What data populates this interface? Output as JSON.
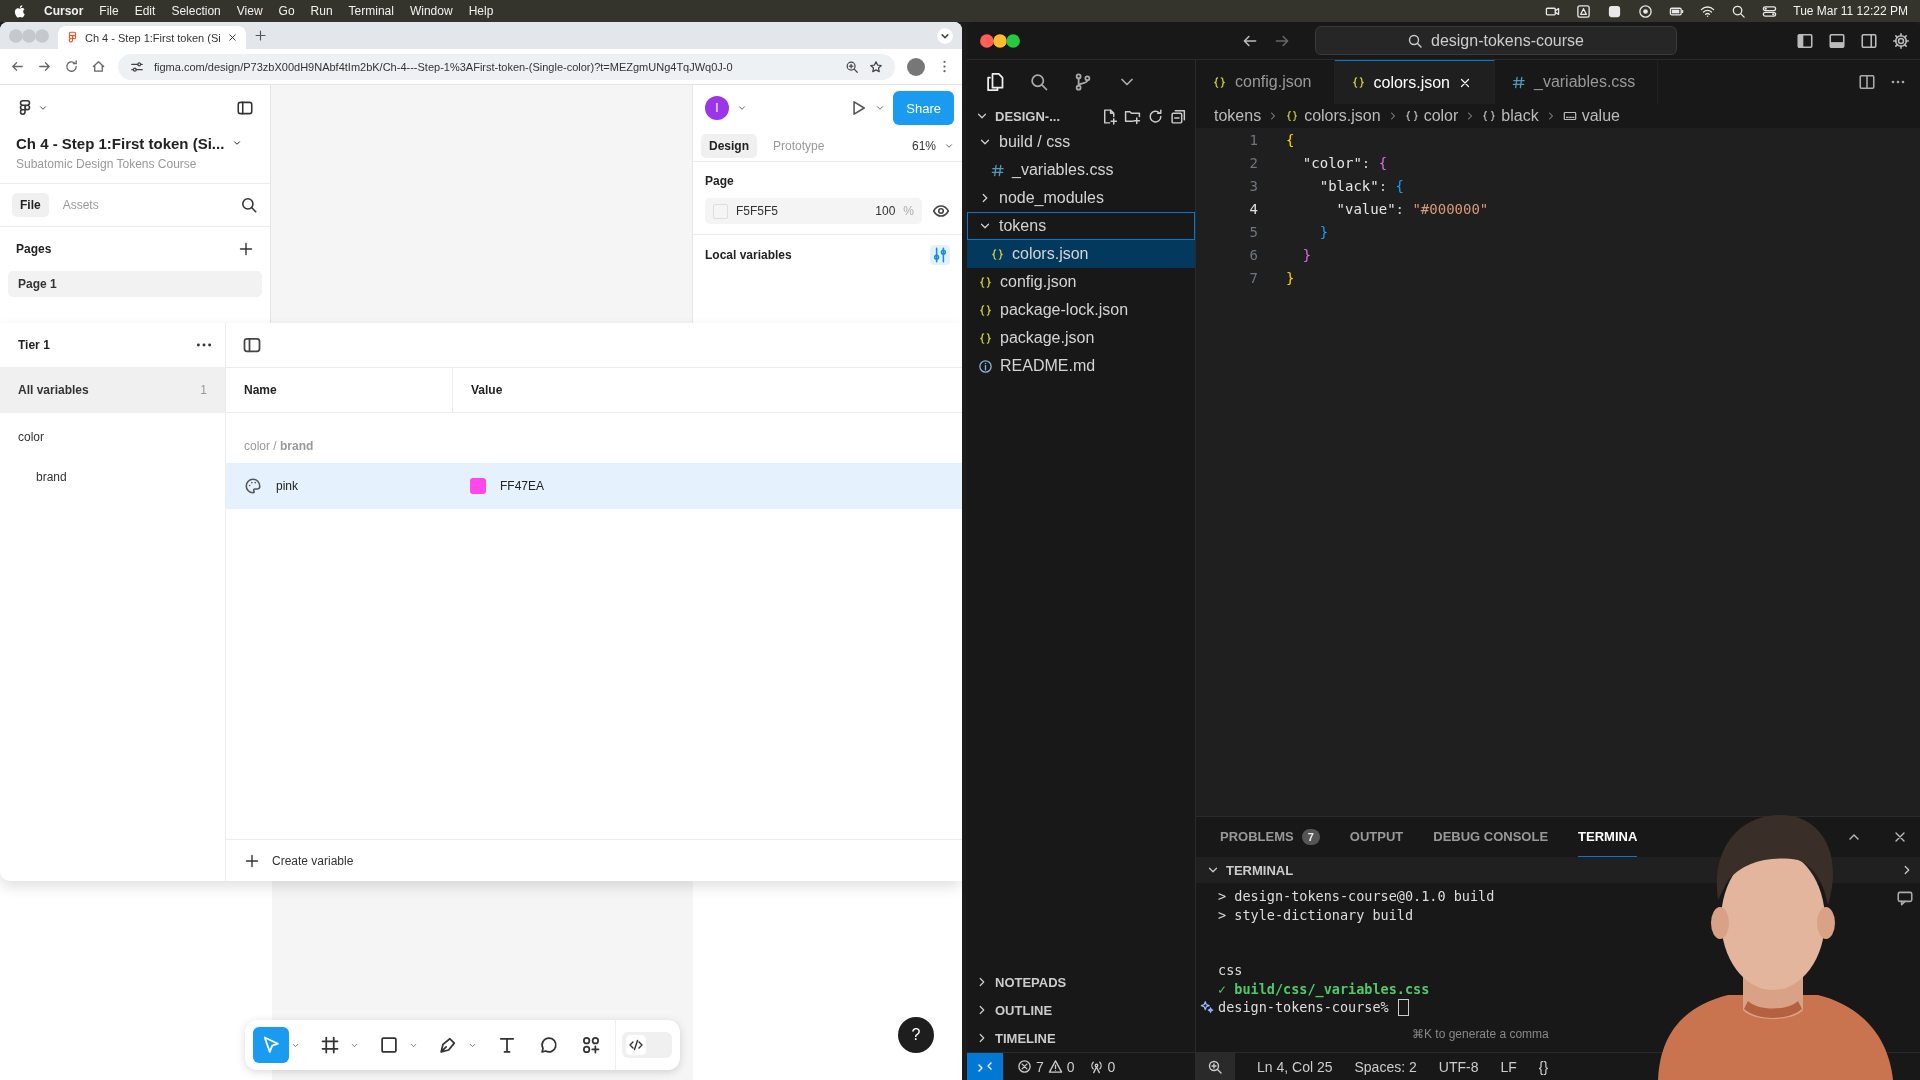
{
  "menu_bar": {
    "app": "Cursor",
    "items": [
      "File",
      "Edit",
      "Selection",
      "View",
      "Go",
      "Run",
      "Terminal",
      "Window",
      "Help"
    ],
    "clock": "Tue Mar 11  12:22 PM"
  },
  "browser": {
    "tab_title": "Ch 4 - Step 1:First token (Si",
    "url": "figma.com/design/P73zbX00dH9NAbf4tIm2bK/Ch-4---Step-1%3AFirst-token-(Single-color)?t=MEZgmUNg4TqJWq0J-0"
  },
  "figma": {
    "file_title": "Ch 4 - Step 1:First token (Si...",
    "project": "Subatomic Design Tokens Course",
    "left_tabs": [
      {
        "label": "File",
        "selected": true
      },
      {
        "label": "Assets",
        "selected": false
      }
    ],
    "pages_heading": "Pages",
    "pages": [
      {
        "label": "Page 1",
        "selected": true
      }
    ],
    "avatar": "I",
    "share": "Share",
    "right_tabs": [
      {
        "label": "Design",
        "selected": true
      },
      {
        "label": "Prototype",
        "selected": false
      }
    ],
    "zoom": "61%",
    "page_section": "Page",
    "page_fill": {
      "hex": "F5F5F5",
      "opacity": "100",
      "unit": "%"
    },
    "local_variables": "Local variables",
    "variables": {
      "collection": "Tier 1",
      "groups": [
        {
          "label": "All variables",
          "count": "1",
          "selected": true
        },
        {
          "label": "color",
          "selected": false,
          "children": [
            {
              "label": "brand",
              "selected": false
            }
          ]
        }
      ],
      "columns": [
        "Name",
        "Value"
      ],
      "group_path": "color / **brand**",
      "rows": [
        {
          "name": "pink",
          "value": "FF47EA",
          "color": "#ff47ea",
          "selected": true
        }
      ],
      "create": "Create variable"
    },
    "tools": [
      {
        "kind": "move",
        "selected": true,
        "menu": true
      },
      {
        "kind": "frame",
        "selected": false,
        "menu": true
      },
      {
        "kind": "shape",
        "selected": false,
        "menu": true
      },
      {
        "kind": "pen",
        "selected": false,
        "menu": true
      },
      {
        "kind": "text",
        "selected": false,
        "menu": false
      },
      {
        "kind": "comment",
        "selected": false,
        "menu": false
      },
      {
        "kind": "actions",
        "selected": false,
        "menu": false
      },
      {
        "kind": "dev",
        "selected": false,
        "menu": false
      }
    ],
    "help": "?"
  },
  "editor": {
    "search": "design-tokens-course",
    "explorer_title": "DESIGN-...",
    "tree": [
      {
        "label": "build / css",
        "kind": "folder",
        "expanded": true,
        "selected": false,
        "focused": false,
        "children": [
          {
            "label": "_variables.css",
            "kind": "css",
            "selected": false,
            "focused": false
          }
        ]
      },
      {
        "label": "node_modules",
        "kind": "folder",
        "expanded": false,
        "selected": false,
        "focused": false
      },
      {
        "label": "tokens",
        "kind": "folder",
        "expanded": true,
        "selected": false,
        "focused": true,
        "children": [
          {
            "label": "colors.json",
            "kind": "json",
            "selected": true,
            "focused": false
          }
        ]
      },
      {
        "label": "config.json",
        "kind": "json",
        "selected": false,
        "focused": false
      },
      {
        "label": "package-lock.json",
        "kind": "json",
        "selected": false,
        "focused": false
      },
      {
        "label": "package.json",
        "kind": "json",
        "selected": false,
        "focused": false
      },
      {
        "label": "README.md",
        "kind": "info",
        "selected": false,
        "focused": false
      }
    ],
    "sections": [
      {
        "label": "NOTEPADS",
        "expanded": false
      },
      {
        "label": "OUTLINE",
        "expanded": false
      },
      {
        "label": "TIMELINE",
        "expanded": false
      }
    ],
    "tabs": [
      {
        "label": "config.json",
        "kind": "json",
        "selected": false
      },
      {
        "label": "colors.json",
        "kind": "json",
        "selected": true
      },
      {
        "label": "_variables.css",
        "kind": "css",
        "selected": false
      }
    ],
    "breadcrumbs": [
      {
        "label": "tokens",
        "kind": "folder"
      },
      {
        "label": "colors.json",
        "kind": "json"
      },
      {
        "label": "color",
        "kind": "object"
      },
      {
        "label": "black",
        "kind": "object"
      },
      {
        "label": "value",
        "kind": "string"
      }
    ],
    "lines": [
      {
        "number": "1",
        "current": false,
        "tokens": [
          {
            "text": "{",
            "kind": "brace-1"
          }
        ]
      },
      {
        "number": "2",
        "current": false,
        "tokens": [
          {
            "text": "  \"color\"",
            "kind": "key"
          },
          {
            "text": ": ",
            "kind": "punct"
          },
          {
            "text": "{",
            "kind": "brace-2"
          }
        ]
      },
      {
        "number": "3",
        "current": false,
        "tokens": [
          {
            "text": "    \"black\"",
            "kind": "key"
          },
          {
            "text": ": ",
            "kind": "punct"
          },
          {
            "text": "{",
            "kind": "brace-3"
          }
        ]
      },
      {
        "number": "4",
        "current": true,
        "tokens": [
          {
            "text": "      \"value\"",
            "kind": "key"
          },
          {
            "text": ": ",
            "kind": "punct"
          },
          {
            "text": "\"#000000\"",
            "kind": "string"
          }
        ]
      },
      {
        "number": "5",
        "current": false,
        "tokens": [
          {
            "text": "    }",
            "kind": "brace-3"
          }
        ]
      },
      {
        "number": "6",
        "current": false,
        "tokens": [
          {
            "text": "  }",
            "kind": "brace-2"
          }
        ]
      },
      {
        "number": "7",
        "current": false,
        "tokens": [
          {
            "text": "}",
            "kind": "brace-1"
          }
        ]
      }
    ],
    "panel_tabs": [
      {
        "label": "PROBLEMS",
        "badge": "7",
        "selected": false
      },
      {
        "label": "OUTPUT",
        "selected": false
      },
      {
        "label": "DEBUG CONSOLE",
        "selected": false
      },
      {
        "label": "TERMINA",
        "selected": true
      }
    ],
    "terminal": {
      "title": "TERMINAL",
      "lines": [
        {
          "kind": "plain",
          "text": "> design-tokens-course@0.1.0 build"
        },
        {
          "kind": "plain",
          "text": "> style-dictionary build"
        },
        {
          "kind": "blank"
        },
        {
          "kind": "blank"
        },
        {
          "kind": "plain",
          "text": "css"
        },
        {
          "kind": "success",
          "text": "✓ build/css/_variables.css"
        },
        {
          "kind": "prompt",
          "text": "design-tokens-course%"
        }
      ],
      "hint": "⌘K to generate a comma"
    },
    "status": {
      "errors": "7",
      "warnings": "0",
      "ports": "0",
      "position": "Ln 4, Col 25",
      "spaces": "Spaces: 2",
      "encoding": "UTF-8",
      "eol": "LF",
      "language": "{}"
    }
  }
}
